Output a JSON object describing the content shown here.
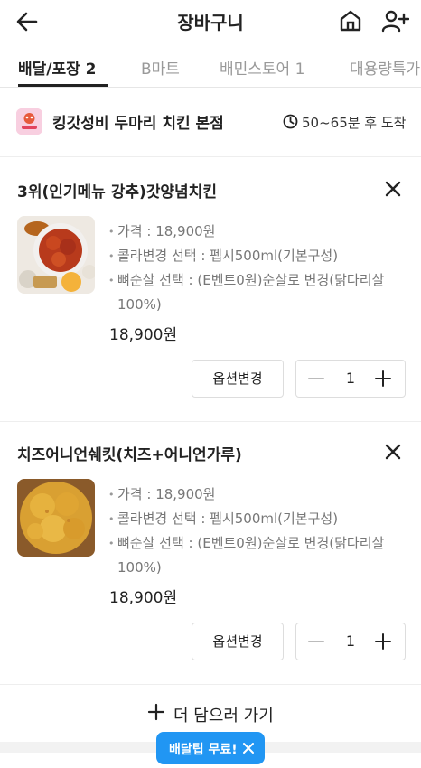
{
  "header": {
    "title": "장바구니"
  },
  "tabs": [
    {
      "label": "배달/포장 2",
      "active": true
    },
    {
      "label": "B마트",
      "active": false
    },
    {
      "label": "배민스토어 1",
      "active": false
    },
    {
      "label": "대용량특가",
      "active": false
    }
  ],
  "store": {
    "name": "킹갓성비 두마리 치킨 본점",
    "eta": "50~65분 후 도착"
  },
  "items": [
    {
      "name": "3위(인기메뉴 강추)갓양념치킨",
      "options": [
        "가격 : 18,900원",
        "콜라변경 선택 : 펩시500ml(기본구성)",
        "뼈순살 선택 : (E벤트0원)순살로 변경(닭다리살 100%)"
      ],
      "price": "18,900원",
      "option_button": "옵션변경",
      "quantity": "1"
    },
    {
      "name": "치즈어니언쉐킷(치즈+어니언가루)",
      "options": [
        "가격 : 18,900원",
        "콜라변경 선택 : 펩시500ml(기본구성)",
        "뼈순살 선택 : (E벤트0원)순살로 변경(닭다리살 100%)"
      ],
      "price": "18,900원",
      "option_button": "옵션변경",
      "quantity": "1"
    }
  ],
  "add_more": {
    "label": "더 담으러 가기"
  },
  "toast": {
    "message": "배달팁 무료!"
  },
  "colors": {
    "accent": "#2196f3",
    "text": "#222222",
    "muted": "#777777"
  }
}
